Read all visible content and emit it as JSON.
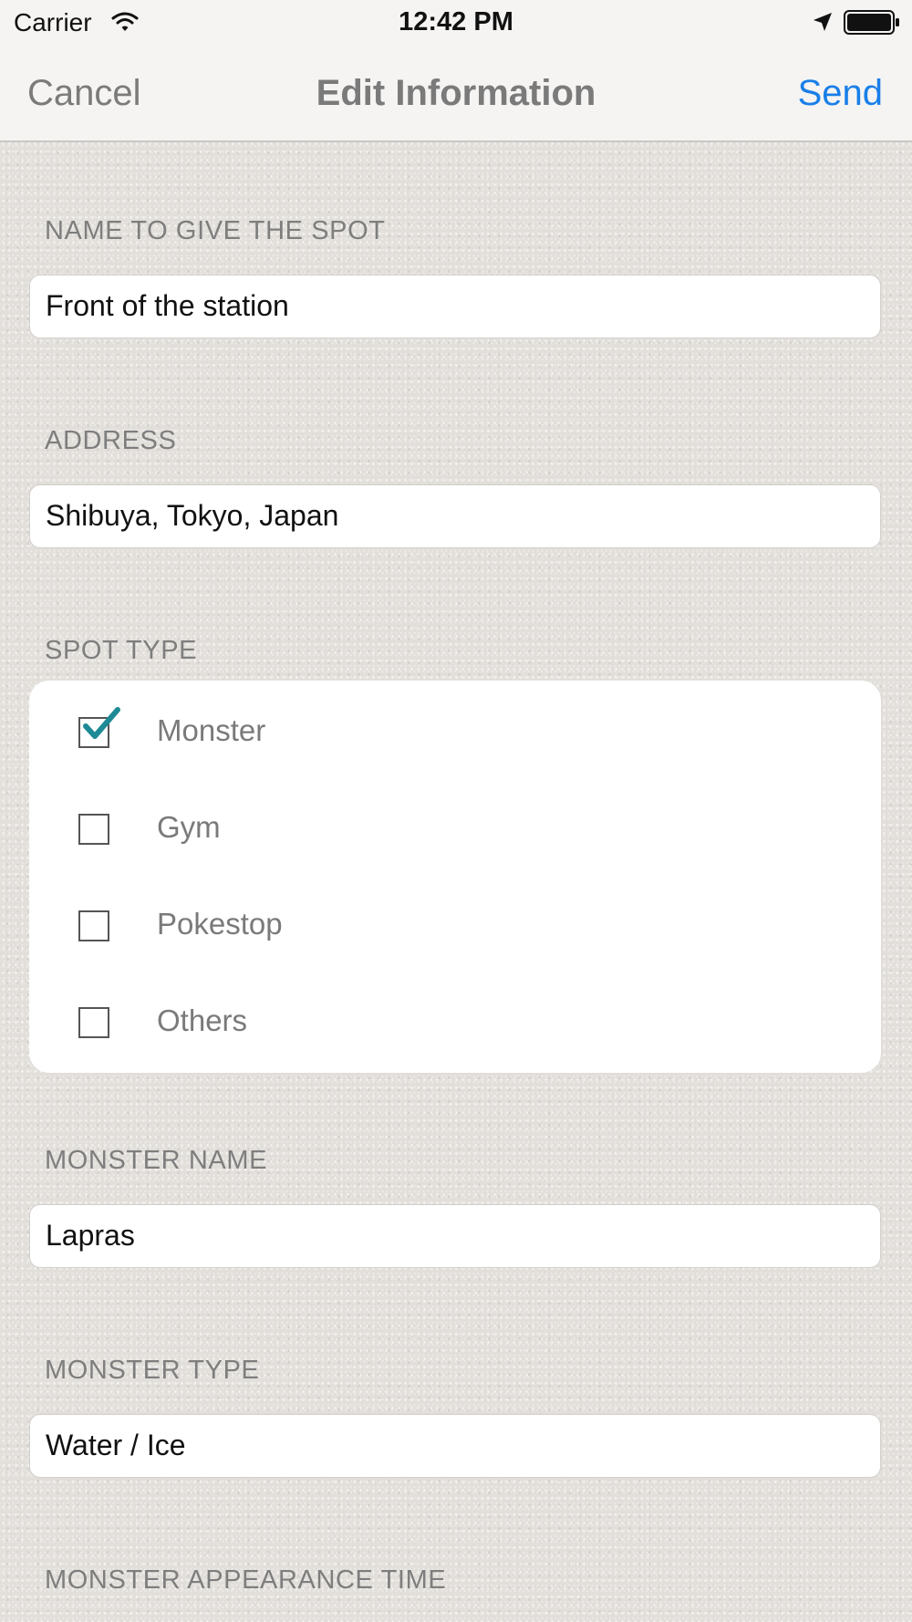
{
  "status_bar": {
    "carrier": "Carrier",
    "time": "12:42 PM"
  },
  "nav": {
    "cancel_label": "Cancel",
    "title": "Edit Information",
    "send_label": "Send",
    "accent_color": "#1a7fe8"
  },
  "form": {
    "spot_name": {
      "label": "NAME TO GIVE THE SPOT",
      "value": "Front of the station"
    },
    "address": {
      "label": "ADDRESS",
      "value": "Shibuya, Tokyo, Japan"
    },
    "spot_type": {
      "label": "SPOT TYPE",
      "options": [
        {
          "label": "Monster",
          "checked": true
        },
        {
          "label": "Gym",
          "checked": false
        },
        {
          "label": "Pokestop",
          "checked": false
        },
        {
          "label": "Others",
          "checked": false
        }
      ],
      "check_color": "#1e8a95"
    },
    "monster_name": {
      "label": "MONSTER NAME",
      "value": "Lapras"
    },
    "monster_type": {
      "label": "MONSTER TYPE",
      "value": "Water / Ice"
    },
    "monster_appearance_time": {
      "label": "MONSTER APPEARANCE TIME"
    }
  }
}
